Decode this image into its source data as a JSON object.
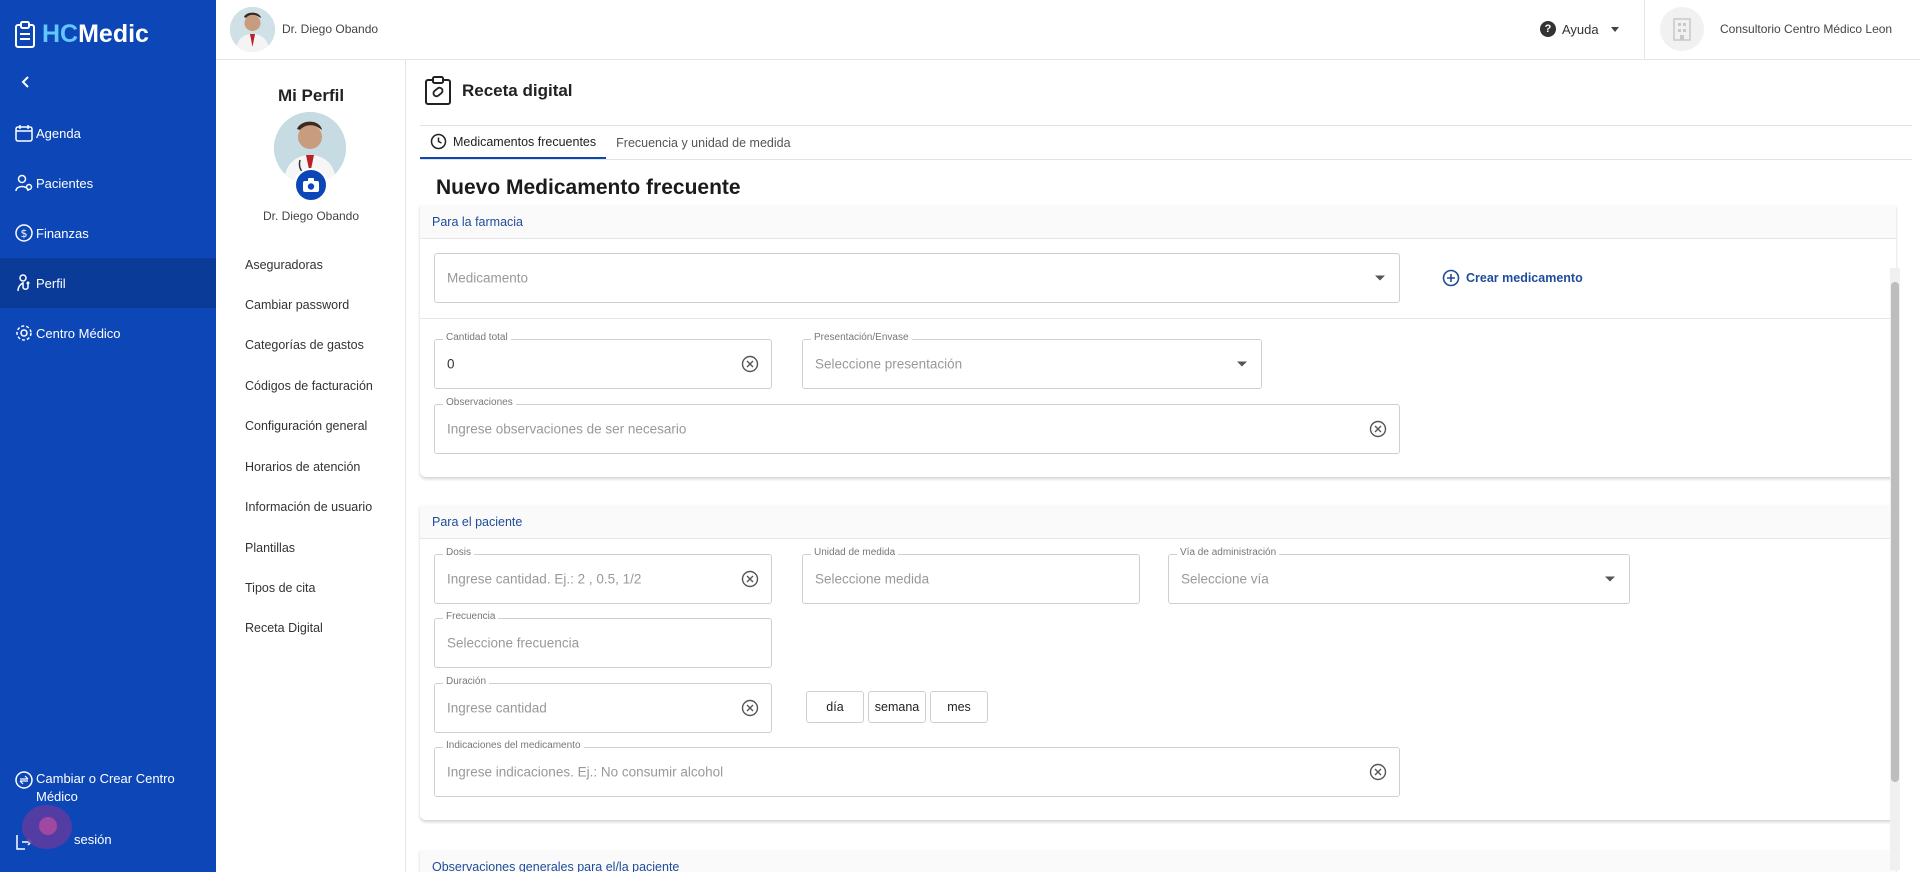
{
  "brand": {
    "logo_hc": "HC",
    "logo_medic": "Medic"
  },
  "leftnav": {
    "items": [
      {
        "label": "Agenda",
        "icon": "calendar-icon"
      },
      {
        "label": "Pacientes",
        "icon": "patients-icon"
      },
      {
        "label": "Finanzas",
        "icon": "dollar-icon"
      },
      {
        "label": "Perfil",
        "icon": "stethoscope-icon",
        "active": true
      },
      {
        "label": "Centro Médico",
        "icon": "gear-icon"
      }
    ],
    "switch_center_label": "Cambiar o Crear Centro Médico",
    "logout_label": "sesión"
  },
  "topbar": {
    "user_name": "Dr. Diego Obando",
    "help_label": "Ayuda",
    "clinic_name": "Consultorio Centro Médico Leon"
  },
  "profile": {
    "title": "Mi Perfil",
    "name": "Dr. Diego Obando",
    "links": [
      "Aseguradoras",
      "Cambiar password",
      "Categorías de gastos",
      "Códigos de facturación",
      "Configuración general",
      "Horarios de atención",
      "Información de usuario",
      "Plantillas",
      "Tipos de cita",
      "Receta Digital"
    ]
  },
  "page": {
    "title": "Receta digital",
    "tabs": [
      {
        "label": "Medicamentos frecuentes",
        "active": true
      },
      {
        "label": "Frecuencia y unidad de medida",
        "active": false
      }
    ],
    "form_title": "Nuevo Medicamento frecuente"
  },
  "pharmacy": {
    "header": "Para la farmacia",
    "medication_placeholder": "Medicamento",
    "create_med_label": "Crear medicamento",
    "total_qty_label": "Cantidad total",
    "total_qty_value": "0",
    "presentation_label": "Presentación/Envase",
    "presentation_placeholder": "Seleccione presentación",
    "observations_label": "Observaciones",
    "observations_placeholder": "Ingrese observaciones de ser necesario"
  },
  "patient": {
    "header": "Para el paciente",
    "dose_label": "Dosis",
    "dose_placeholder": "Ingrese cantidad. Ej.: 2 , 0.5, 1/2",
    "unit_label": "Unidad de medida",
    "unit_placeholder": "Seleccione medida",
    "route_label": "Vía de administración",
    "route_placeholder": "Seleccione vía",
    "frequency_label": "Frecuencia",
    "frequency_placeholder": "Seleccione frecuencia",
    "duration_label": "Duración",
    "duration_placeholder": "Ingrese cantidad",
    "duration_units": [
      "día",
      "semana",
      "mes"
    ],
    "indications_label": "Indicaciones del medicamento",
    "indications_placeholder": "Ingrese indicaciones. Ej.: No consumir alcohol"
  },
  "general": {
    "header": "Observaciones generales para el/la paciente"
  },
  "colors": {
    "nav_blue": "#0d47b7",
    "nav_active": "#0a3b98",
    "link_blue": "#1e4c9a",
    "logo_accent": "#62c6ff"
  }
}
